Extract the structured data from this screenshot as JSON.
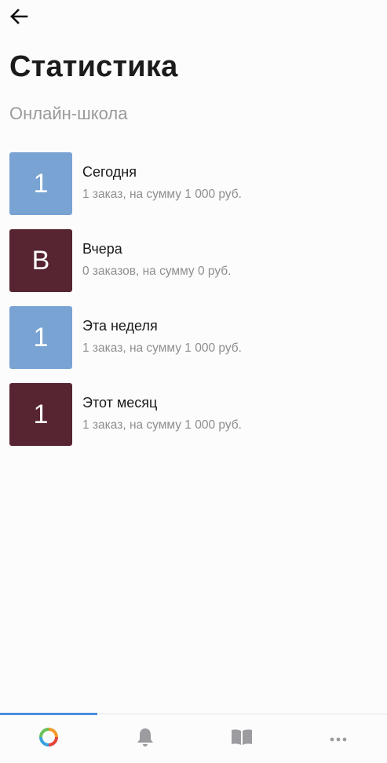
{
  "header": {
    "back_icon": "arrow-left-icon",
    "title": "Статистика",
    "subtitle": "Онлайн-школа"
  },
  "stats": [
    {
      "badge": "1",
      "label": "Сегодня",
      "summary": "1 заказ, на сумму 1 000 руб.",
      "color": "#79a3d3"
    },
    {
      "badge": "В",
      "label": "Вчера",
      "summary": "0 заказов, на сумму 0 руб.",
      "color": "#572531"
    },
    {
      "badge": "1",
      "label": "Эта неделя",
      "summary": "1 заказ, на сумму 1 000 руб.",
      "color": "#79a3d3"
    },
    {
      "badge": "1",
      "label": "Этот месяц",
      "summary": "1 заказ, на сумму 1 000 руб.",
      "color": "#572531"
    }
  ],
  "bottom_nav": {
    "active_index": 0,
    "accent_color": "#4a8fe0",
    "items": [
      {
        "icon": "app-logo-icon"
      },
      {
        "icon": "bell-icon"
      },
      {
        "icon": "book-icon"
      },
      {
        "icon": "more-icon"
      }
    ]
  }
}
